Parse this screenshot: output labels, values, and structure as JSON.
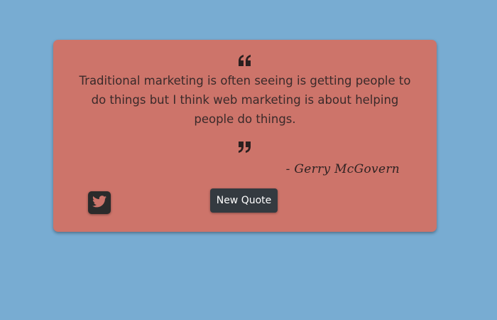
{
  "quote": {
    "text": "Traditional marketing is often seeing is getting people to do things but I think web marketing is about helping people do things.",
    "author": "- Gerry McGovern",
    "open_icon": "quote-left-icon",
    "close_icon": "quote-right-icon"
  },
  "actions": {
    "new_quote_label": "New Quote",
    "tweet_icon": "twitter-icon"
  },
  "colors": {
    "background": "#78acd2",
    "card": "#cd746a",
    "button": "#343a40",
    "text": "#3a2a2a"
  }
}
